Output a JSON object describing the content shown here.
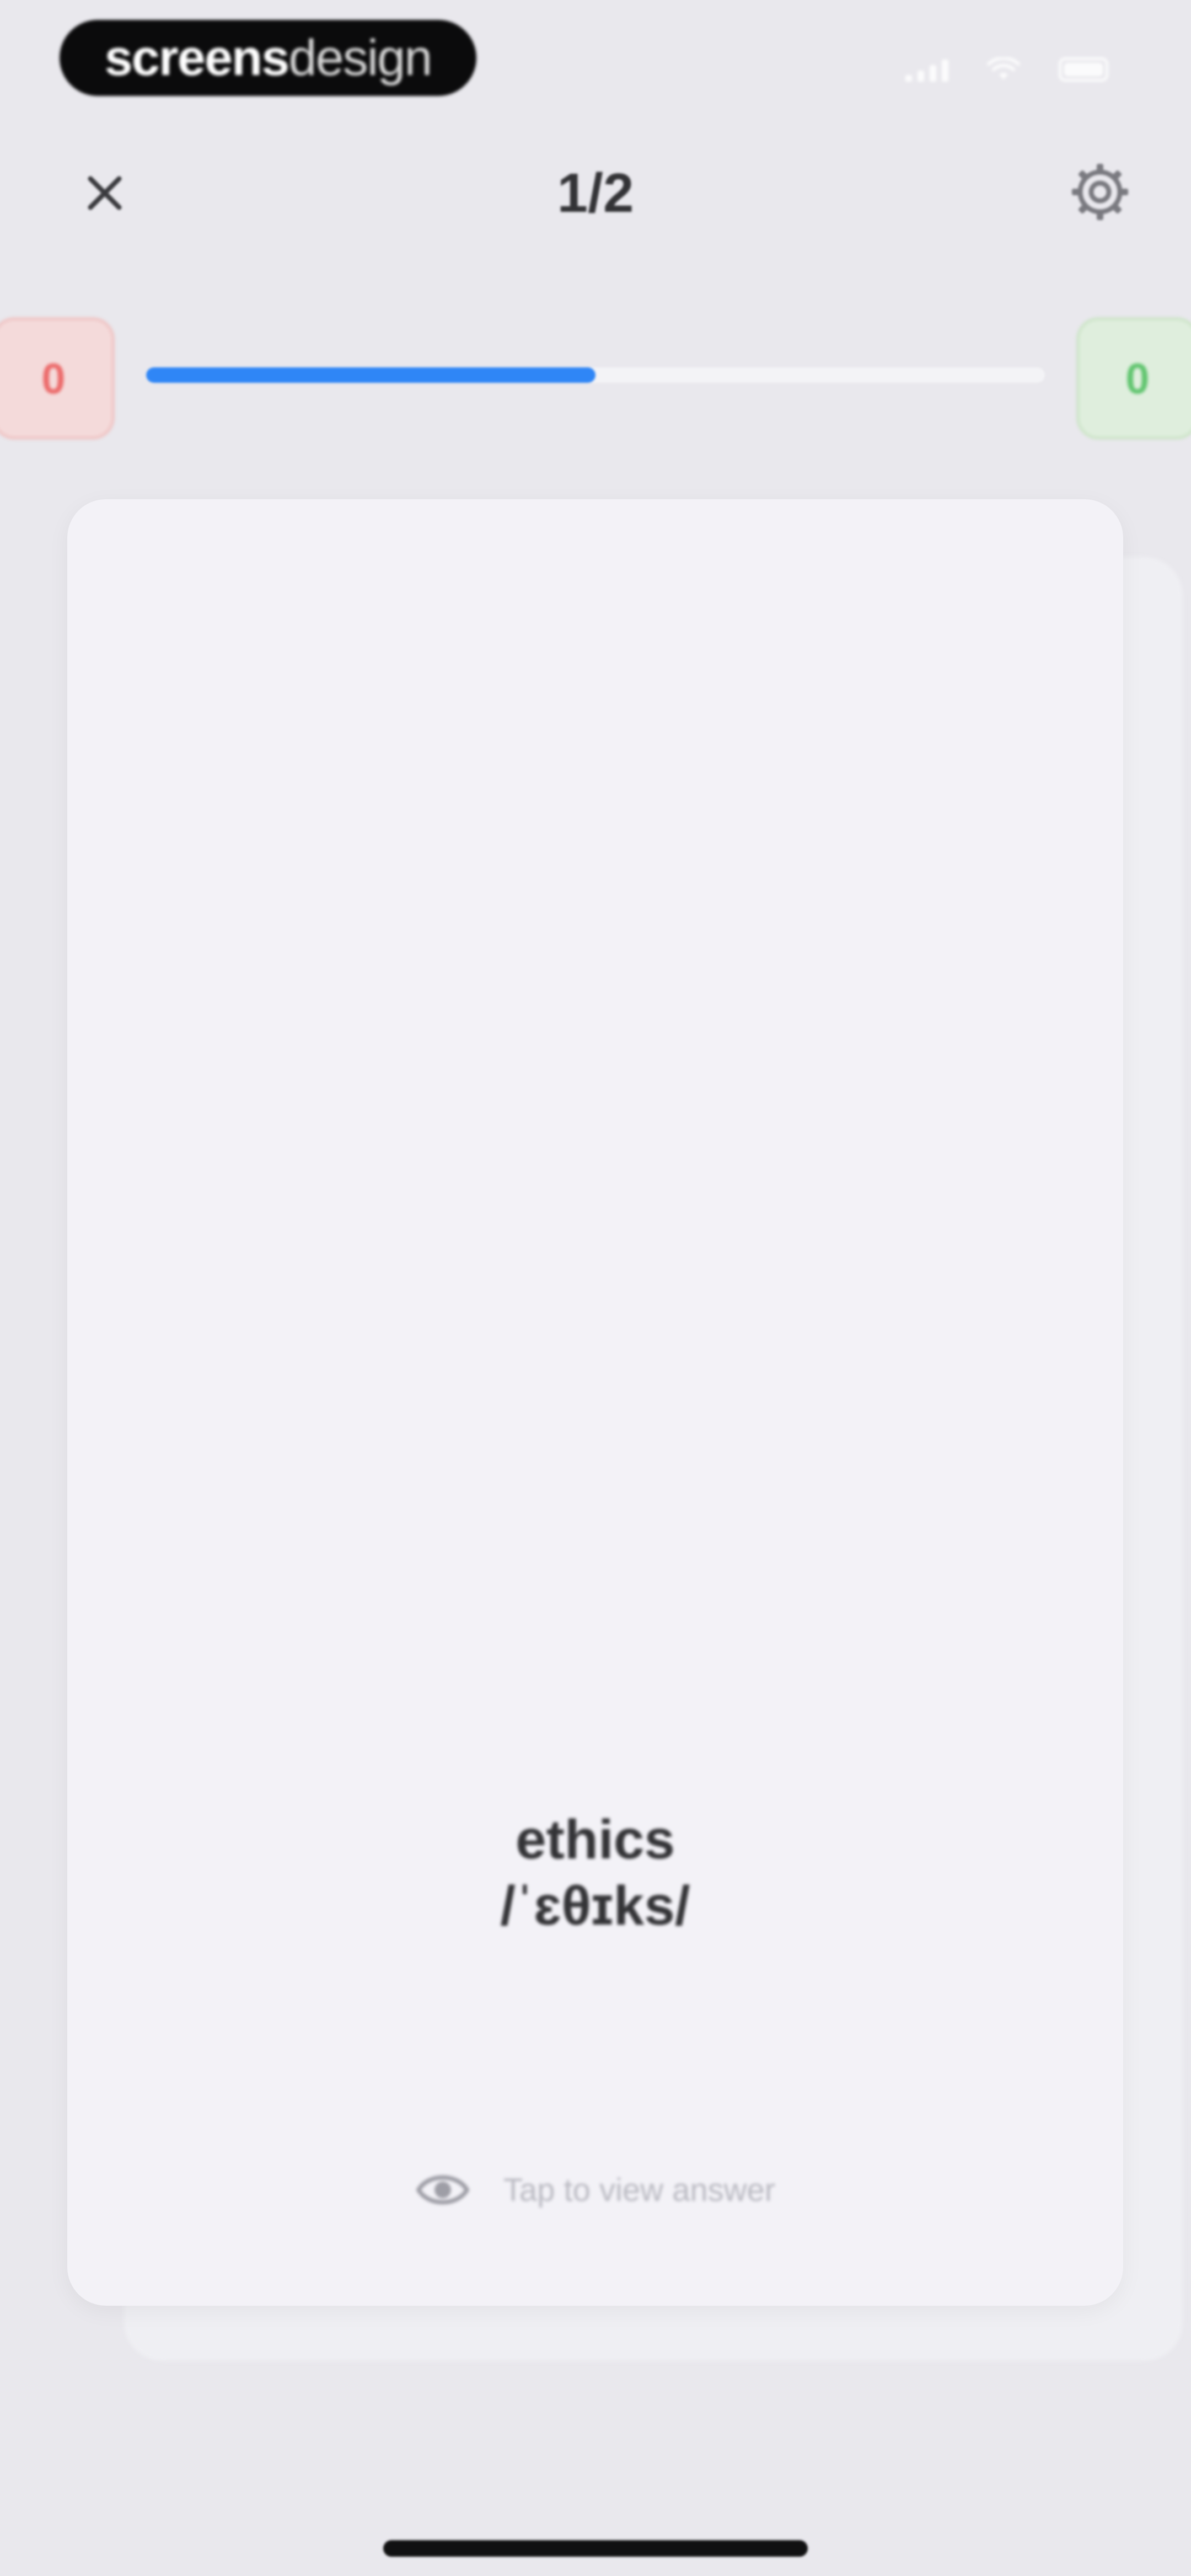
{
  "branding": {
    "strong": "screens",
    "light": "design"
  },
  "header": {
    "counter": "1/2",
    "close_icon": "close-icon",
    "settings_icon": "gear-icon"
  },
  "scores": {
    "wrong": "0",
    "correct": "0"
  },
  "progress": {
    "fraction": 0.5
  },
  "card": {
    "word": "ethics",
    "phonetic": "/ˈɛθɪks/",
    "reveal_text": "Tap to view answer",
    "reveal_icon": "eye-icon"
  },
  "colors": {
    "accent": "#2f86f6",
    "wrong": "#ec6b6b",
    "correct": "#61c56f"
  }
}
